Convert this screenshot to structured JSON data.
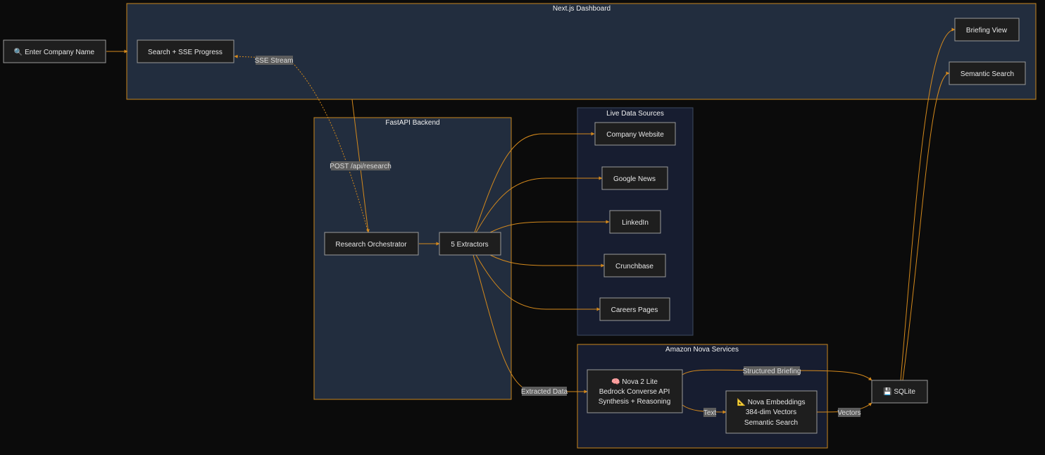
{
  "clusters": {
    "dashboard": "Next.js Dashboard",
    "backend": "FastAPI Backend",
    "sources": "Live Data Sources",
    "nova": "Amazon Nova Services"
  },
  "nodes": {
    "input": "🔍 Enter Company Name",
    "search": "Search + SSE Progress",
    "briefing": "Briefing View",
    "semantic": "Semantic Search",
    "orchestrator": "Research Orchestrator",
    "extractors": "5 Extractors",
    "website": "Company Website",
    "news": "Google News",
    "linkedin": "LinkedIn",
    "crunchbase": "Crunchbase",
    "careers": "Careers Pages",
    "nova_lite": [
      "🧠 Nova 2 Lite",
      "Bedrock Converse API",
      "Synthesis + Reasoning"
    ],
    "embeddings": [
      "📐 Nova Embeddings",
      "384-dim Vectors",
      "Semantic Search"
    ],
    "sqlite": "💾 SQLite"
  },
  "edge_labels": {
    "sse": "SSE Stream",
    "post": "POST /api/research",
    "extracted": "Extracted Data",
    "structured": "Structured Briefing",
    "text": "Text",
    "vectors": "Vectors"
  },
  "colors": {
    "background": "#0b0b0b",
    "cluster_fill": "#222d3e",
    "cluster_fill_dark": "#171d30",
    "cluster_border": "#c8861e",
    "node_fill": "#1e1e1e",
    "node_border": "#9a9a9a",
    "edge": "#d4891c",
    "edge_label_bg": "#5d5d5d"
  }
}
